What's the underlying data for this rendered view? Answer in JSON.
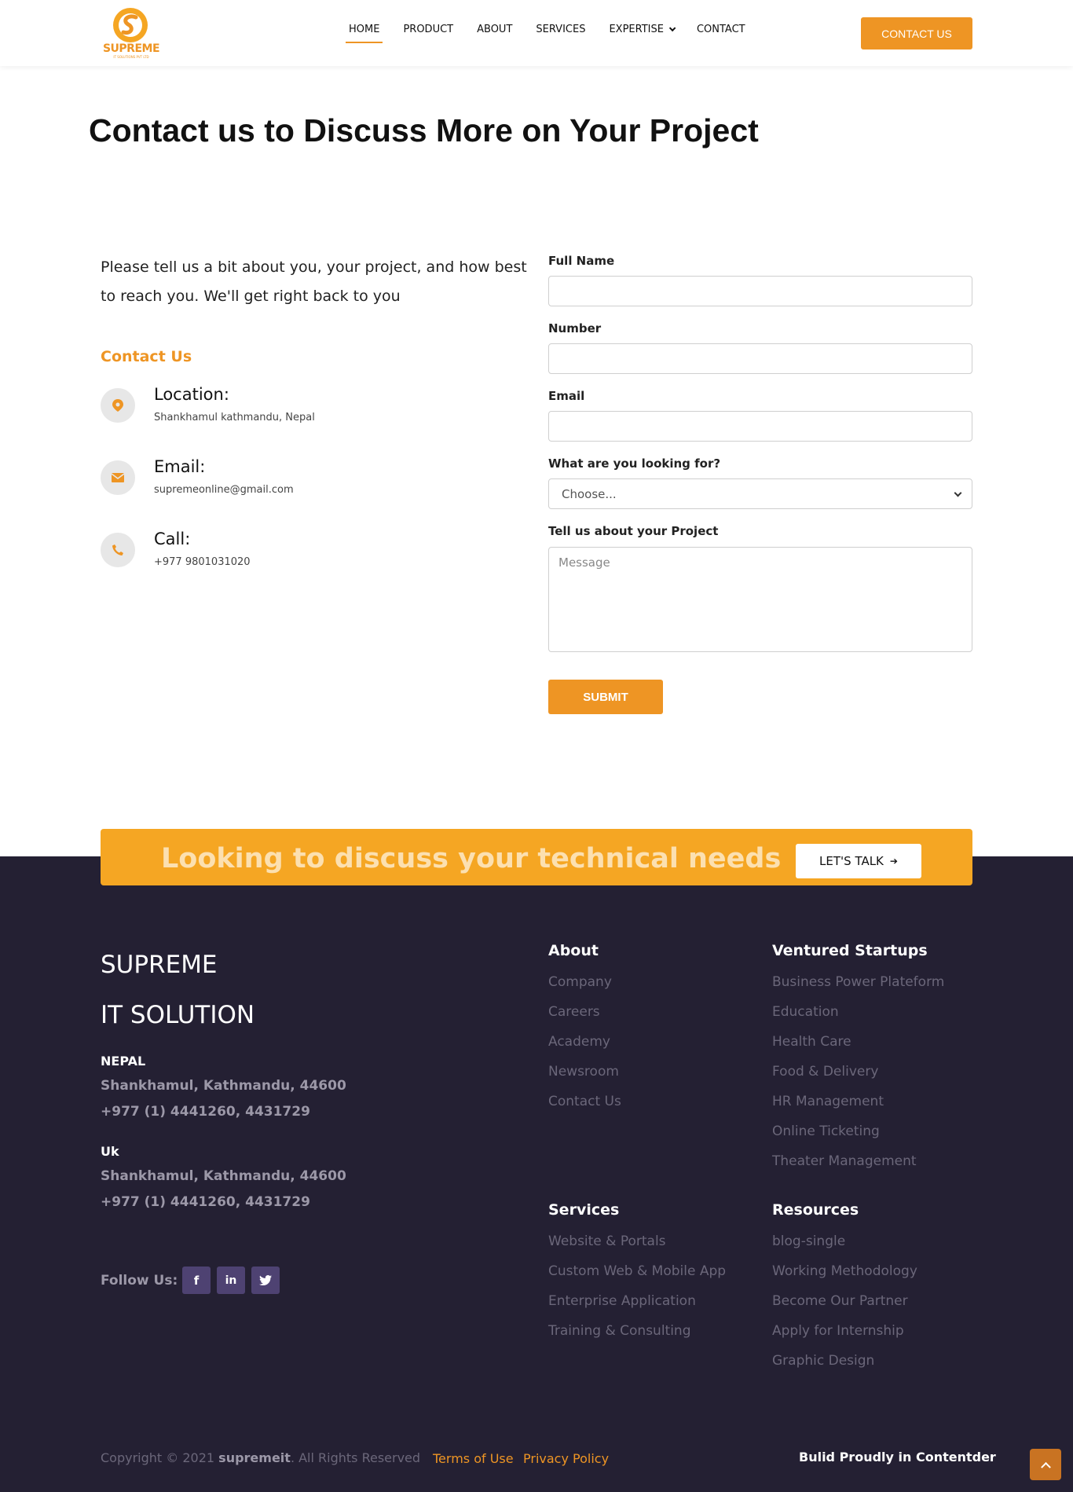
{
  "header": {
    "logo_text": "SUPREME",
    "logo_sub": "IT SOLUTIONS PVT LTD",
    "nav": [
      "HOME",
      "PRODUCT",
      "ABOUT",
      "SERVICES",
      "EXPERTISE",
      "CONTACT"
    ],
    "cta": "CONTACT US"
  },
  "main": {
    "title": "Contact us to Discuss More on Your Project",
    "intro": "Please tell us a bit about you, your project, and how best to reach you. We'll get right back to you",
    "contact_heading": "Contact Us",
    "info": [
      {
        "title": "Location:",
        "value": "Shankhamul kathmandu, Nepal",
        "icon": "map-pin-icon"
      },
      {
        "title": "Email:",
        "value": "supremeonline@gmail.com",
        "icon": "envelope-icon"
      },
      {
        "title": "Call:",
        "value": "+977 9801031020",
        "icon": "phone-icon"
      }
    ]
  },
  "form": {
    "full_name_label": "Full Name",
    "number_label": "Number",
    "email_label": "Email",
    "looking_for_label": "What are you looking for?",
    "looking_for_value": "Choose...",
    "project_label": "Tell us about your Project",
    "message_placeholder": "Message",
    "submit": "SUBMIT"
  },
  "banner": {
    "text": "Looking to discuss your technical needs",
    "button": "LET'S TALK",
    "arrow": "➔"
  },
  "footer": {
    "brand_line1": "SUPREME",
    "brand_line2": "IT SOLUTION",
    "offices": [
      {
        "country": "NEPAL",
        "address": "Shankhamul, Kathmandu, 44600",
        "phone": "+977 (1) 4441260, 4431729"
      },
      {
        "country": "Uk",
        "address": "Shankhamul, Kathmandu, 44600",
        "phone": "+977 (1) 4441260, 4431729"
      }
    ],
    "follow": "Follow Us:",
    "social": [
      {
        "icon": "facebook-icon",
        "glyph": "f"
      },
      {
        "icon": "linkedin-icon",
        "glyph": "in"
      },
      {
        "icon": "twitter-icon",
        "glyph": "t"
      }
    ],
    "about": {
      "title": "About",
      "links": [
        "Company",
        "Careers",
        "Academy",
        "Newsroom",
        "Contact Us"
      ]
    },
    "ventured": {
      "title": "Ventured Startups",
      "links": [
        "Business Power Plateform",
        "Education",
        "Health Care",
        "Food & Delivery",
        "HR Management",
        "Online Ticketing",
        "Theater Management"
      ]
    },
    "services": {
      "title": "Services",
      "links": [
        "Website & Portals",
        "Custom Web & Mobile App",
        "Enterprise Application",
        "Training & Consulting"
      ]
    },
    "resources": {
      "title": "Resources",
      "links": [
        "blog-single",
        "Working Methodology",
        "Become Our Partner",
        "Apply for Internship",
        "Graphic Design"
      ]
    },
    "copyright_prefix": "Copyright © 2021",
    "copyright_brand": "supremeit",
    "copyright_suffix": ". All Rights Reserved",
    "terms": "Terms of Use",
    "privacy": "Privacy Policy",
    "built": "Bulid Proudly in Contentder"
  },
  "colors": {
    "accent": "#ee9524",
    "footer_bg": "#242033",
    "social_bg": "#4e4272",
    "banner_bg": "#f5a623"
  }
}
